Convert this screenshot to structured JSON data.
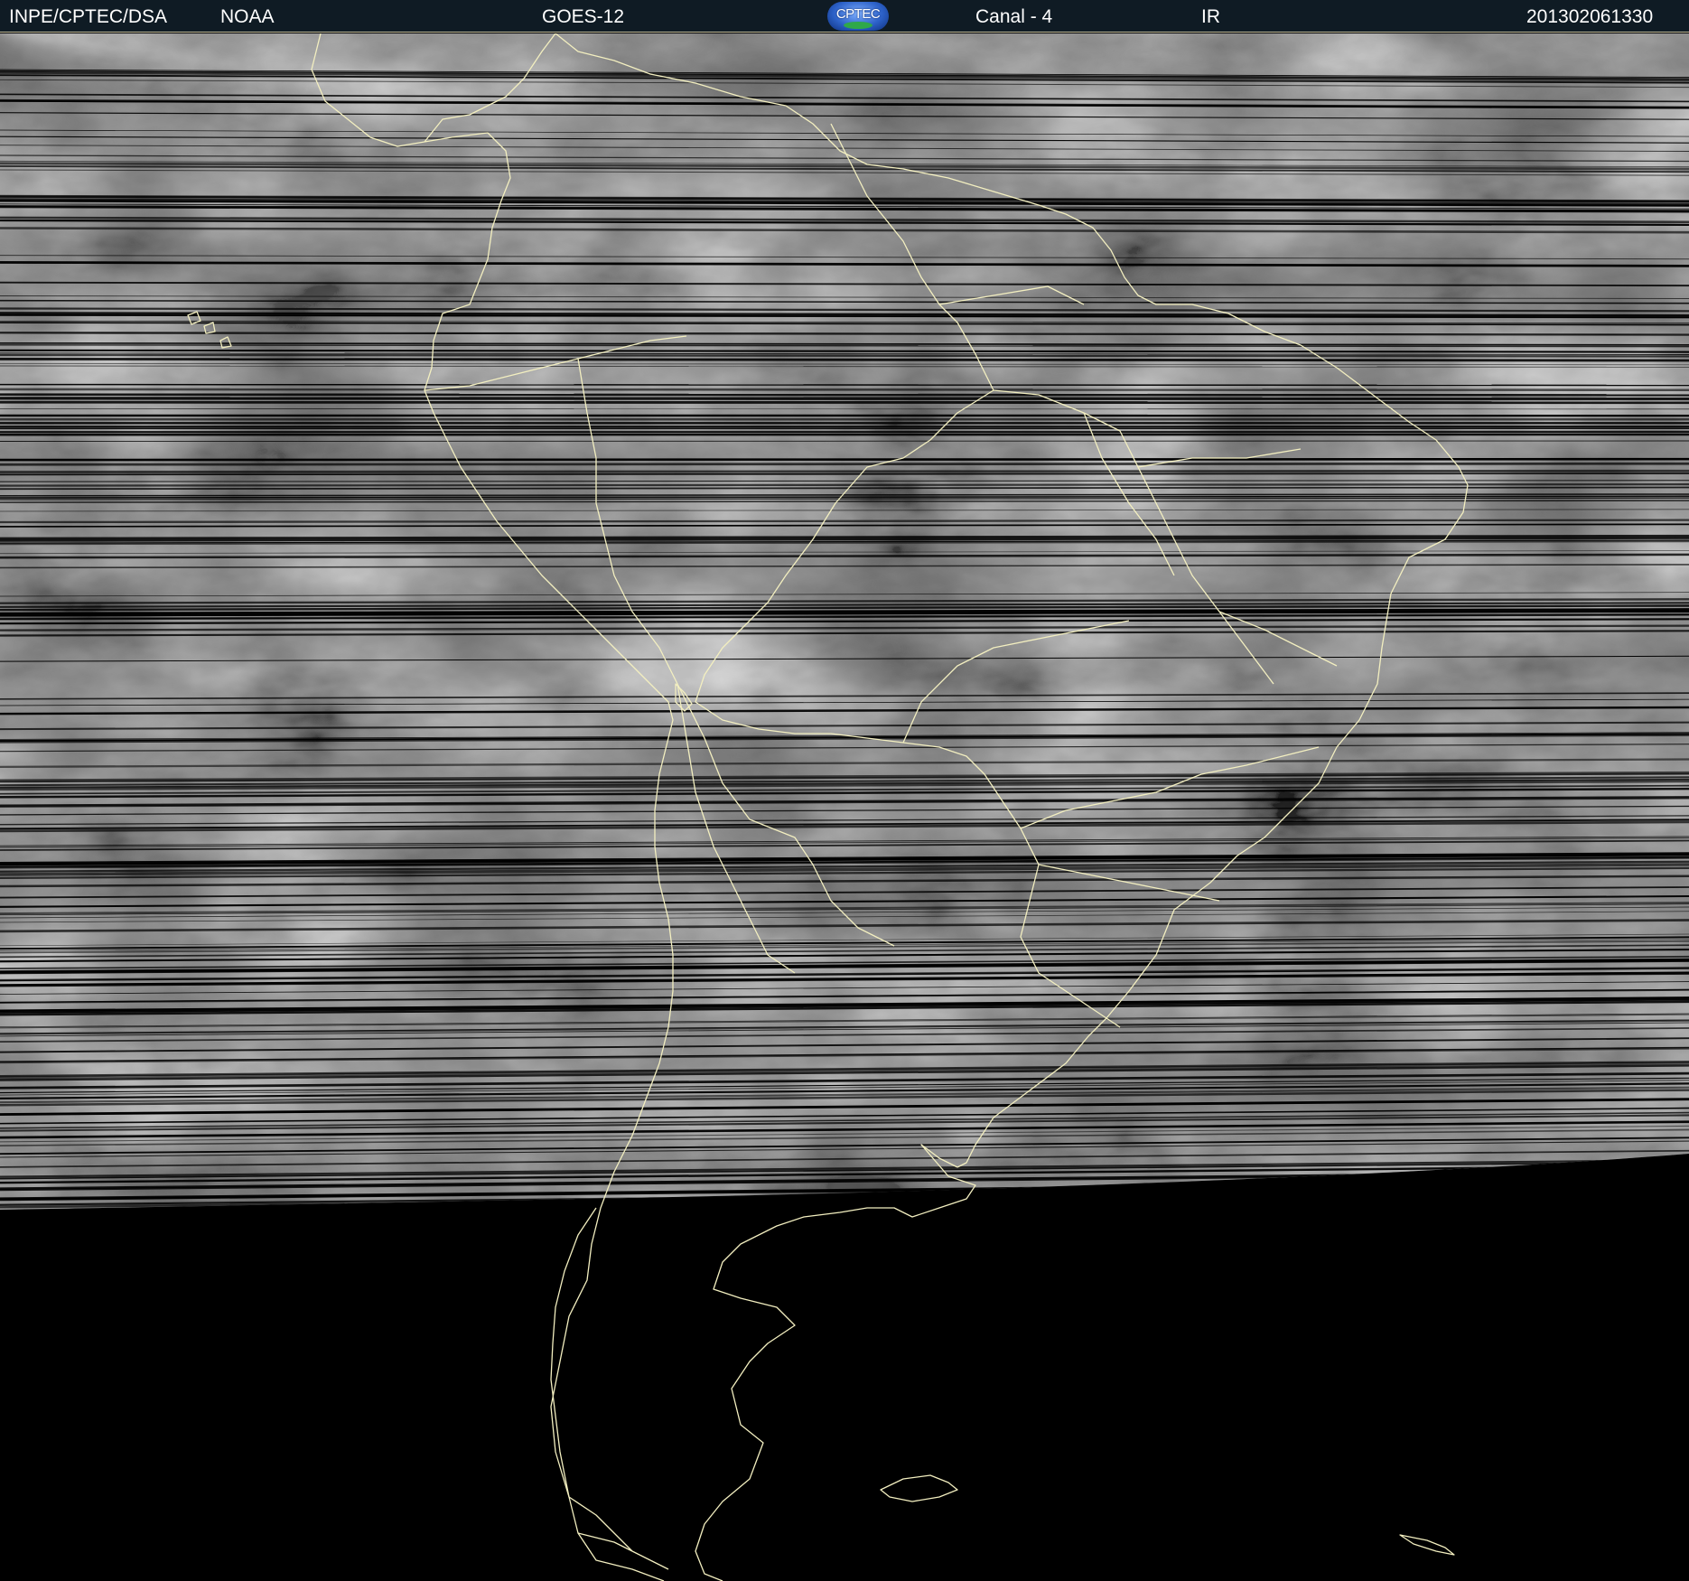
{
  "header": {
    "organization": "INPE/CPTEC/DSA",
    "agency": "NOAA",
    "satellite": "GOES-12",
    "logo_text": "CPTEC",
    "channel": "Canal - 4",
    "band": "IR",
    "timestamp": "201302061330"
  },
  "colors": {
    "header_background": "#0f1b24",
    "header_text": "#ffffff",
    "coastline": "#f3efc0",
    "space_background": "#000000",
    "cloud_base": "#6e6e6e"
  },
  "icons": {
    "logo": "cptec-globe-logo-icon"
  }
}
